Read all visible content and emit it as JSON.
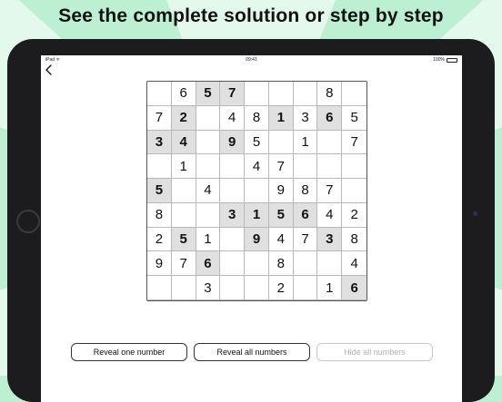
{
  "headline": "See the complete solution or step by step",
  "status": {
    "left": "iPad ᯤ",
    "time": "09:41",
    "battery": "100%"
  },
  "nav": {
    "back_icon": "chevron-left-icon"
  },
  "board": [
    [
      "",
      "6",
      "5",
      "7",
      "",
      "",
      "",
      "8",
      ""
    ],
    [
      "7",
      "2",
      "",
      "4",
      "8",
      "1",
      "3",
      "6",
      "5"
    ],
    [
      "3",
      "4",
      "",
      "9",
      "5",
      "",
      "1",
      "",
      "7"
    ],
    [
      "",
      "1",
      "",
      "",
      "4",
      "7",
      "",
      "",
      ""
    ],
    [
      "5",
      "",
      "4",
      "",
      "",
      "9",
      "8",
      "7",
      ""
    ],
    [
      "8",
      "",
      "",
      "3",
      "1",
      "5",
      "6",
      "4",
      "2"
    ],
    [
      "2",
      "5",
      "1",
      "",
      "9",
      "4",
      "7",
      "3",
      "8"
    ],
    [
      "9",
      "7",
      "6",
      "",
      "",
      "8",
      "",
      "",
      "4"
    ],
    [
      "",
      "",
      "3",
      "",
      "",
      "2",
      "",
      "1",
      "6"
    ]
  ],
  "given": [
    [
      0,
      0,
      1,
      1,
      0,
      0,
      0,
      0,
      0
    ],
    [
      0,
      1,
      0,
      0,
      0,
      1,
      0,
      1,
      0
    ],
    [
      1,
      1,
      0,
      1,
      0,
      0,
      0,
      0,
      0
    ],
    [
      0,
      0,
      0,
      0,
      0,
      0,
      0,
      0,
      0
    ],
    [
      1,
      0,
      0,
      0,
      0,
      0,
      0,
      0,
      0
    ],
    [
      0,
      0,
      0,
      1,
      1,
      1,
      1,
      0,
      0
    ],
    [
      0,
      1,
      0,
      0,
      1,
      0,
      0,
      1,
      0
    ],
    [
      0,
      0,
      1,
      0,
      0,
      0,
      0,
      0,
      0
    ],
    [
      0,
      0,
      0,
      0,
      0,
      0,
      0,
      0,
      1
    ]
  ],
  "buttons": {
    "reveal_one": "Reveal one number",
    "reveal_all": "Reveal all numbers",
    "hide_all": "Hide all numbers"
  },
  "colors": {
    "background": "#bdf0d2",
    "given_cell": "#e0e0e0",
    "device": "#1c1c1e"
  }
}
